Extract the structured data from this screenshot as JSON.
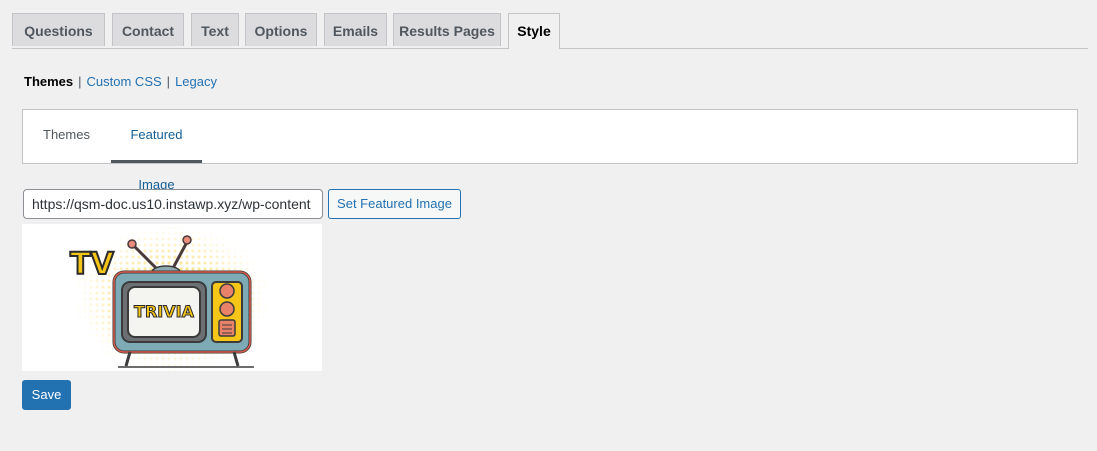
{
  "tabs": [
    {
      "label": "Questions"
    },
    {
      "label": "Contact"
    },
    {
      "label": "Text"
    },
    {
      "label": "Options"
    },
    {
      "label": "Emails"
    },
    {
      "label": "Results Pages"
    },
    {
      "label": "Style",
      "active": true
    }
  ],
  "sublinks": {
    "current": "Themes",
    "separator": "|",
    "custom_css": "Custom CSS",
    "legacy": "Legacy"
  },
  "inner_tabs": {
    "themes": "Themes",
    "featured_image": "Featured Image",
    "active": "Featured Image"
  },
  "featured": {
    "url_value": "https://qsm-doc.us10.instawp.xyz/wp-content",
    "set_button": "Set Featured Image",
    "image_text_top": "TV",
    "image_text_screen": "TRIVIA"
  },
  "save_label": "Save",
  "colors": {
    "accent": "#2271b1",
    "tv_yellow": "#f5c518",
    "tv_teal": "#7eaab5"
  }
}
